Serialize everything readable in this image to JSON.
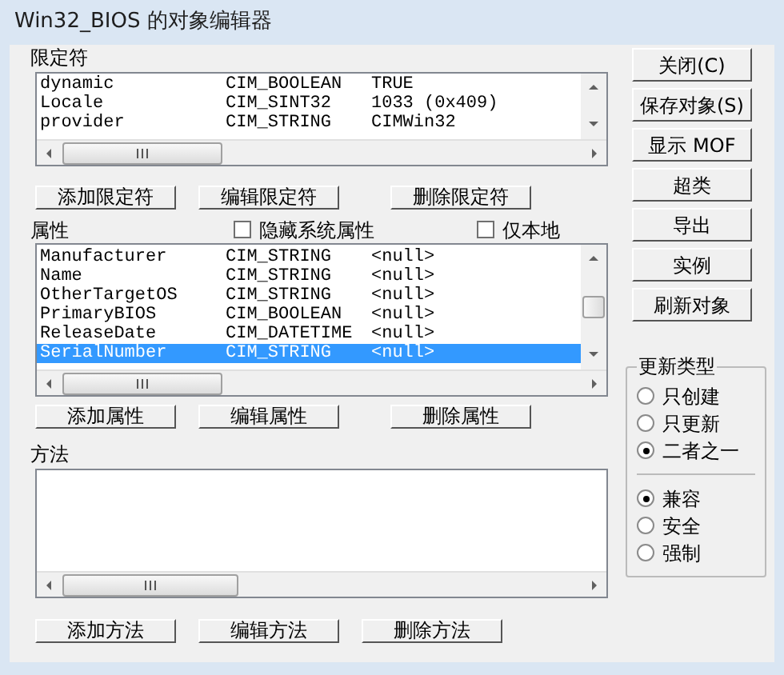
{
  "window": {
    "title": "Win32_BIOS 的对象编辑器"
  },
  "qualifiers": {
    "label": "限定符",
    "rows": [
      {
        "name": "dynamic",
        "type": "CIM_BOOLEAN",
        "value": "TRUE"
      },
      {
        "name": "Locale",
        "type": "CIM_SINT32",
        "value": "1033 (0x409)"
      },
      {
        "name": "provider",
        "type": "CIM_STRING",
        "value": "CIMWin32"
      }
    ],
    "buttons": [
      "添加限定符",
      "编辑限定符",
      "删除限定符"
    ]
  },
  "properties": {
    "label": "属性",
    "checkboxes": [
      {
        "label": "隐藏系统属性",
        "checked": false
      },
      {
        "label": "仅本地",
        "checked": false
      }
    ],
    "rows": [
      {
        "name": "Manufacturer",
        "type": "CIM_STRING",
        "value": "<null>",
        "selected": false
      },
      {
        "name": "Name",
        "type": "CIM_STRING",
        "value": "<null>",
        "selected": false
      },
      {
        "name": "OtherTargetOS",
        "type": "CIM_STRING",
        "value": "<null>",
        "selected": false
      },
      {
        "name": "PrimaryBIOS",
        "type": "CIM_BOOLEAN",
        "value": "<null>",
        "selected": false
      },
      {
        "name": "ReleaseDate",
        "type": "CIM_DATETIME",
        "value": "<null>",
        "selected": false
      },
      {
        "name": "SerialNumber",
        "type": "CIM_STRING",
        "value": "<null>",
        "selected": true
      }
    ],
    "buttons": [
      "添加属性",
      "编辑属性",
      "删除属性"
    ]
  },
  "methods": {
    "label": "方法",
    "buttons": [
      "添加方法",
      "编辑方法",
      "删除方法"
    ]
  },
  "side_buttons": [
    "关闭(C)",
    "保存对象(S)",
    "显示 MOF",
    "超类",
    "导出",
    "实例",
    "刷新对象"
  ],
  "update_type": {
    "label": "更新类型",
    "options": [
      {
        "label": "只创建",
        "selected": false
      },
      {
        "label": "只更新",
        "selected": false
      },
      {
        "label": "二者之一",
        "selected": true
      }
    ],
    "modes": [
      {
        "label": "兼容",
        "selected": true
      },
      {
        "label": "安全",
        "selected": false
      },
      {
        "label": "强制",
        "selected": false
      }
    ]
  }
}
